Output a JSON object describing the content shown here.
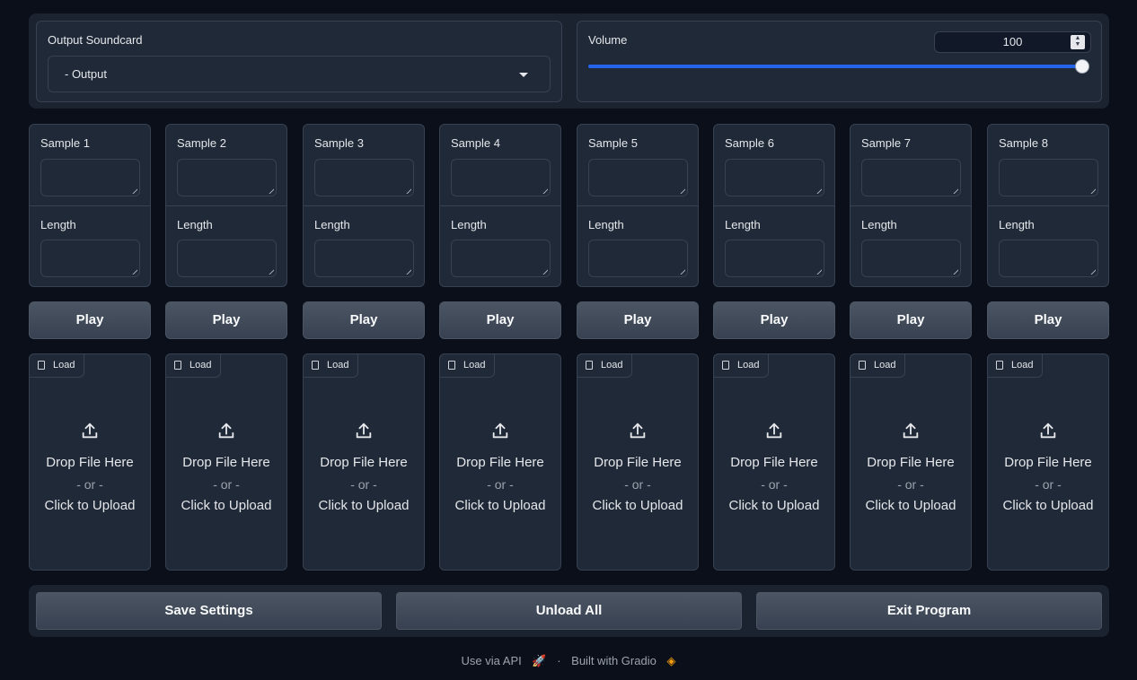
{
  "soundcard": {
    "label": "Output Soundcard",
    "value": "- Output"
  },
  "volume": {
    "label": "Volume",
    "value": "100",
    "level_percent": 100
  },
  "samples": [
    {
      "label": "Sample 1",
      "length_label": "Length",
      "play": "Play",
      "load": "Load",
      "drop": "Drop File Here",
      "or": "- or -",
      "click": "Click to Upload"
    },
    {
      "label": "Sample 2",
      "length_label": "Length",
      "play": "Play",
      "load": "Load",
      "drop": "Drop File Here",
      "or": "- or -",
      "click": "Click to Upload"
    },
    {
      "label": "Sample 3",
      "length_label": "Length",
      "play": "Play",
      "load": "Load",
      "drop": "Drop File Here",
      "or": "- or -",
      "click": "Click to Upload"
    },
    {
      "label": "Sample 4",
      "length_label": "Length",
      "play": "Play",
      "load": "Load",
      "drop": "Drop File Here",
      "or": "- or -",
      "click": "Click to Upload"
    },
    {
      "label": "Sample 5",
      "length_label": "Length",
      "play": "Play",
      "load": "Load",
      "drop": "Drop File Here",
      "or": "- or -",
      "click": "Click to Upload"
    },
    {
      "label": "Sample 6",
      "length_label": "Length",
      "play": "Play",
      "load": "Load",
      "drop": "Drop File Here",
      "or": "- or -",
      "click": "Click to Upload"
    },
    {
      "label": "Sample 7",
      "length_label": "Length",
      "play": "Play",
      "load": "Load",
      "drop": "Drop File Here",
      "or": "- or -",
      "click": "Click to Upload"
    },
    {
      "label": "Sample 8",
      "length_label": "Length",
      "play": "Play",
      "load": "Load",
      "drop": "Drop File Here",
      "or": "- or -",
      "click": "Click to Upload"
    }
  ],
  "actions": {
    "save": "Save Settings",
    "unload": "Unload All",
    "exit": "Exit Program"
  },
  "footer": {
    "api": "Use via API",
    "dot": "·",
    "built": "Built with Gradio"
  },
  "colors": {
    "accent": "#2563eb",
    "background": "#0b0f19",
    "panel": "#1f2937"
  }
}
